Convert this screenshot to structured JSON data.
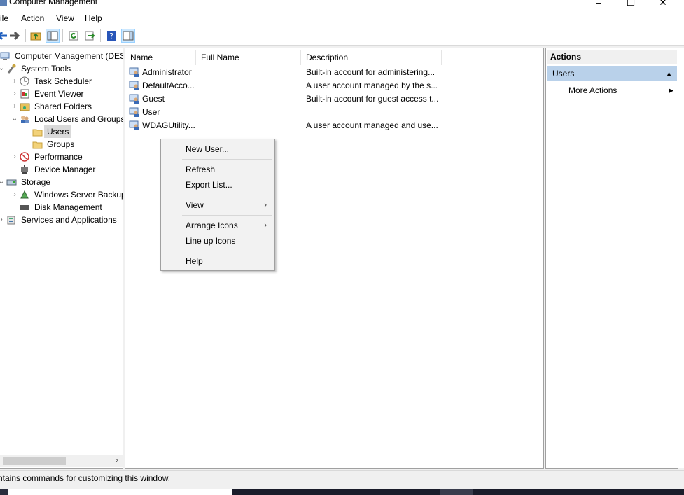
{
  "window": {
    "title": "Computer Management"
  },
  "menu": [
    "ile",
    "Action",
    "View",
    "Help"
  ],
  "tree": [
    {
      "label": "Computer Management (DESK",
      "icon": "computer-management-icon",
      "indent": 0,
      "expander": ""
    },
    {
      "label": "System Tools",
      "icon": "tools-icon",
      "indent": 1,
      "expander": "⌄"
    },
    {
      "label": "Task Scheduler",
      "icon": "clock-icon",
      "indent": 2,
      "expander": "›"
    },
    {
      "label": "Event Viewer",
      "icon": "event-viewer-icon",
      "indent": 2,
      "expander": "›"
    },
    {
      "label": "Shared Folders",
      "icon": "shared-folder-icon",
      "indent": 2,
      "expander": "›"
    },
    {
      "label": "Local Users and Groups",
      "icon": "users-icon",
      "indent": 2,
      "expander": "⌄"
    },
    {
      "label": "Users",
      "icon": "folder-icon",
      "indent": 3,
      "expander": "",
      "selected": true
    },
    {
      "label": "Groups",
      "icon": "folder-icon",
      "indent": 3,
      "expander": ""
    },
    {
      "label": "Performance",
      "icon": "performance-icon",
      "indent": 2,
      "expander": "›"
    },
    {
      "label": "Device Manager",
      "icon": "device-manager-icon",
      "indent": 2,
      "expander": ""
    },
    {
      "label": "Storage",
      "icon": "storage-icon",
      "indent": 1,
      "expander": "⌄"
    },
    {
      "label": "Windows Server Backup",
      "icon": "backup-icon",
      "indent": 2,
      "expander": "›"
    },
    {
      "label": "Disk Management",
      "icon": "disk-icon",
      "indent": 2,
      "expander": ""
    },
    {
      "label": "Services and Applications",
      "icon": "services-icon",
      "indent": 1,
      "expander": "›"
    }
  ],
  "list": {
    "columns": [
      "Name",
      "Full Name",
      "Description"
    ],
    "rows": [
      {
        "name": "Administrator",
        "full_name": "",
        "description": "Built-in account for administering..."
      },
      {
        "name": "DefaultAcco...",
        "full_name": "",
        "description": "A user account managed by the s..."
      },
      {
        "name": "Guest",
        "full_name": "",
        "description": "Built-in account for guest access t..."
      },
      {
        "name": "User",
        "full_name": "",
        "description": ""
      },
      {
        "name": "WDAGUtility...",
        "full_name": "",
        "description": "A user account managed and use..."
      }
    ]
  },
  "context_menu": {
    "new_user": "New User...",
    "refresh": "Refresh",
    "export_list": "Export List...",
    "view": "View",
    "arrange_icons": "Arrange Icons",
    "line_up_icons": "Line up Icons",
    "help": "Help",
    "submenu_arrow": "›"
  },
  "actions": {
    "header": "Actions",
    "section": "Users",
    "section_arrow": "▲",
    "more_actions": "More Actions",
    "more_arrow": "▶"
  },
  "status": "ntains commands for customizing this window.",
  "colors": {
    "selection": "#cce8ff",
    "actions_section": "#b9d1ea"
  }
}
